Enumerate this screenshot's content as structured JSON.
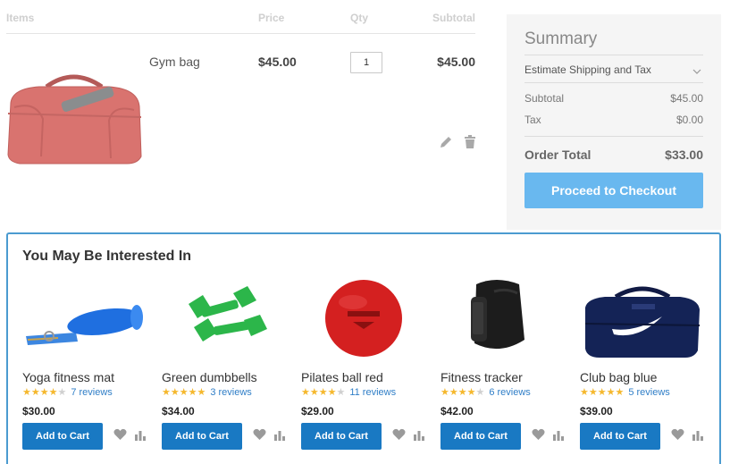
{
  "cart": {
    "headers": {
      "items": "Items",
      "price": "Price",
      "qty": "Qty",
      "subtotal": "Subtotal"
    },
    "item": {
      "name": "Gym bag",
      "price": "$45.00",
      "qty": "1",
      "subtotal": "$45.00",
      "image_icon": "red-duffel-bag"
    }
  },
  "summary": {
    "title": "Summary",
    "shipping_label": "Estimate Shipping and Tax",
    "subtotal_label": "Subtotal",
    "subtotal_value": "$45.00",
    "tax_label": "Tax",
    "tax_value": "$0.00",
    "total_label": "Order Total",
    "total_value": "$33.00",
    "checkout_label": "Proceed to Checkout"
  },
  "interest": {
    "title": "You May Be Interested In",
    "add_label": "Add to Cart",
    "products": [
      {
        "name": "Yoga fitness mat",
        "rating": 4,
        "reviews": "7 reviews",
        "price": "$30.00",
        "image_icon": "blue-yoga-mat"
      },
      {
        "name": "Green dumbbells",
        "rating": 5,
        "reviews": "3 reviews",
        "price": "$34.00",
        "image_icon": "green-dumbbells"
      },
      {
        "name": "Pilates ball red",
        "rating": 4,
        "reviews": "11 reviews",
        "price": "$29.00",
        "image_icon": "red-pilates-ball"
      },
      {
        "name": "Fitness tracker",
        "rating": 4,
        "reviews": "6 reviews",
        "price": "$42.00",
        "image_icon": "black-fitness-tracker"
      },
      {
        "name": "Club bag blue",
        "rating": 5,
        "reviews": "5 reviews",
        "price": "$39.00",
        "image_icon": "navy-club-bag"
      }
    ]
  },
  "colors": {
    "accent": "#1979c3",
    "checkout": "#69b8ef",
    "star": "#f5b82e",
    "link": "#2f7ec7"
  }
}
